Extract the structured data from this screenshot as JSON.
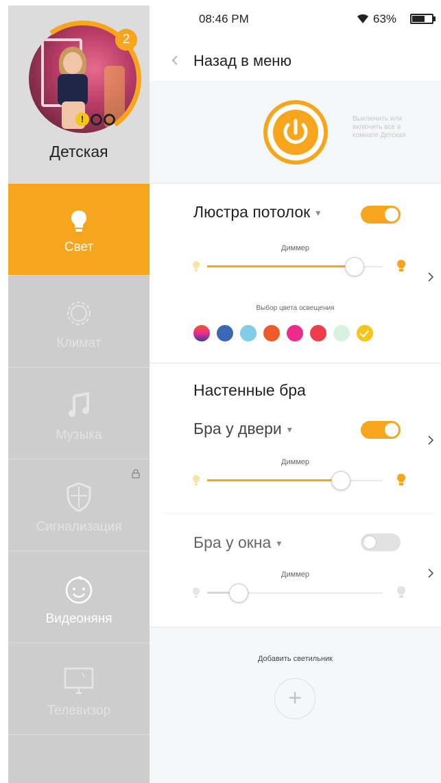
{
  "colors": {
    "accent": "#f7a51c",
    "sidebar": "#cdcdcd",
    "sidebar_profile": "#dcdcdc"
  },
  "profile": {
    "room_name": "Детская",
    "badge_count": "2"
  },
  "nav": [
    {
      "label": "Свет",
      "icon": "bulb-icon",
      "active": true
    },
    {
      "label": "Климат",
      "icon": "gear-icon"
    },
    {
      "label": "Музыка",
      "icon": "music-note-icon"
    },
    {
      "label": "Сигнализация",
      "icon": "shield-icon",
      "locked": true
    },
    {
      "label": "Видеоняня",
      "icon": "baby-face-icon"
    },
    {
      "label": "Телевизор",
      "icon": "tv-icon"
    }
  ],
  "status_bar": {
    "time": "08:46 PM",
    "battery": "63%",
    "battery_level": 0.63
  },
  "header": {
    "back_label": "Назад в меню"
  },
  "power": {
    "hint": "Выключить или включить все в комнате Детская"
  },
  "section1": {
    "title": "Люстра потолок",
    "toggle_on": true,
    "dimmer_label": "Диммер",
    "dimmer_value": 0.84,
    "palette_label": "Выбор цвета освещения",
    "palette": [
      "gradient",
      "#3b67b7",
      "#7fcde6",
      "#f05a28",
      "#ec2b8c",
      "#ee3d4b",
      "#d9f1e0",
      "#f5c518"
    ],
    "palette_selected": 7
  },
  "section2": {
    "group_title": "Настенные бра",
    "lamp1": {
      "title": "Бра у двери",
      "toggle_on": true,
      "dimmer_label": "Диммер",
      "dimmer_value": 0.76
    },
    "lamp2": {
      "title": "Бра у окна",
      "toggle_on": false,
      "dimmer_label": "Диммер",
      "dimmer_value": 0.18
    }
  },
  "add": {
    "label": "Добавить светильник",
    "plus": "+"
  }
}
